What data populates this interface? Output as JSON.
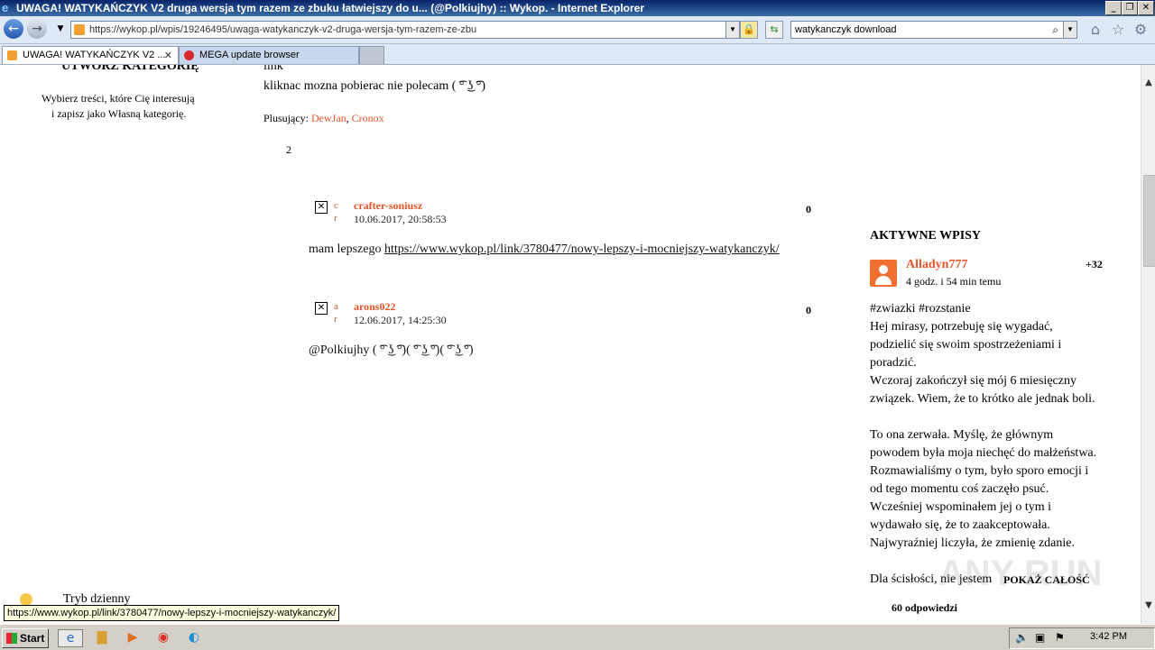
{
  "window": {
    "title": "UWAGA! WATYKAŃCZYK V2 druga wersja tym razem ze zbuku łatwiejszy do u... (@Polkiujhy) :: Wykop. - Internet Explorer"
  },
  "navbar": {
    "url": "https://wykop.pl/wpis/19246495/uwaga-watykanczyk-v2-druga-wersja-tym-razem-ze-zbu",
    "search_value": "watykanczyk download"
  },
  "tabs": [
    {
      "label": "UWAGA! WATYKAŃCZYK V2 ..."
    },
    {
      "label": "MEGA update browser"
    }
  ],
  "left_sidebar": {
    "heading": "UTWÓRZ KATEGORIĘ",
    "desc_line1": "Wybierz treści, które Cię interesują",
    "desc_line2": "i zapisz jako Własną kategorię.",
    "day_mode": "Tryb dzienny"
  },
  "post": {
    "line_link": "link",
    "line_text": "kliknac mozna pobierac nie polecam ( ͡° ͜ʖ ͡°)",
    "plusujacy_label": "Plusujący:",
    "plusujacy_user1": "DewJan",
    "separator": ",",
    "plusujacy_user2": "Cronox",
    "count": "2"
  },
  "comments": [
    {
      "avatar_letter1": "c",
      "avatar_letter2": "r",
      "user": "crafter-soniusz",
      "date": "10.06.2017, 20:58:53",
      "score": "0",
      "text_prefix": "mam lepszego ",
      "link": "https://www.wykop.pl/link/3780477/nowy-lepszy-i-mocniejszy-watykanczyk/"
    },
    {
      "avatar_letter1": "a",
      "avatar_letter2": "r",
      "user": "arons022",
      "date": "12.06.2017, 14:25:30",
      "score": "0",
      "text": "@Polkiujhy ( ͡° ͜ʖ ͡°)( ͡° ͜ʖ ͡°)( ͡° ͜ʖ ͡°)"
    }
  ],
  "active_entries": {
    "title": "AKTYWNE WPISY",
    "user": "Alladyn777",
    "time": "4 godz. i 54 min temu",
    "score": "+32",
    "lines": [
      "#zwiazki #rozstanie",
      "Hej mirasy, potrzebuję się wygadać,",
      "podzielić się swoim spostrzeżeniami i",
      "poradzić.",
      "Wczoraj zakończył się mój 6 miesięczny",
      "związek. Wiem, że to krótko ale jednak boli.",
      "",
      "To ona zerwała. Myślę, że głównym",
      "powodem była moja niechęć do małżeństwa.",
      "Rozmawialiśmy o tym, było sporo emocji i",
      "od tego momentu coś zaczęło psuć.",
      "Wcześniej wspominałem jej o tym i",
      "wydawało się, że to zaakceptowała.",
      "Najwyraźniej liczyła, że zmienię zdanie.",
      "",
      "Dla ścisłości, nie jestem"
    ],
    "show_all": "POKAŻ CAŁOŚĆ",
    "replies": "60 odpowiedzi"
  },
  "statusbar": {
    "url": "https://www.wykop.pl/link/3780477/nowy-lepszy-i-mocniejszy-watykanczyk/"
  },
  "taskbar": {
    "start": "Start",
    "clock": "3:42 PM"
  },
  "watermark": "ANY RUN",
  "colors": {
    "accent": "#e4542b",
    "titlebar": "#0a246a"
  }
}
